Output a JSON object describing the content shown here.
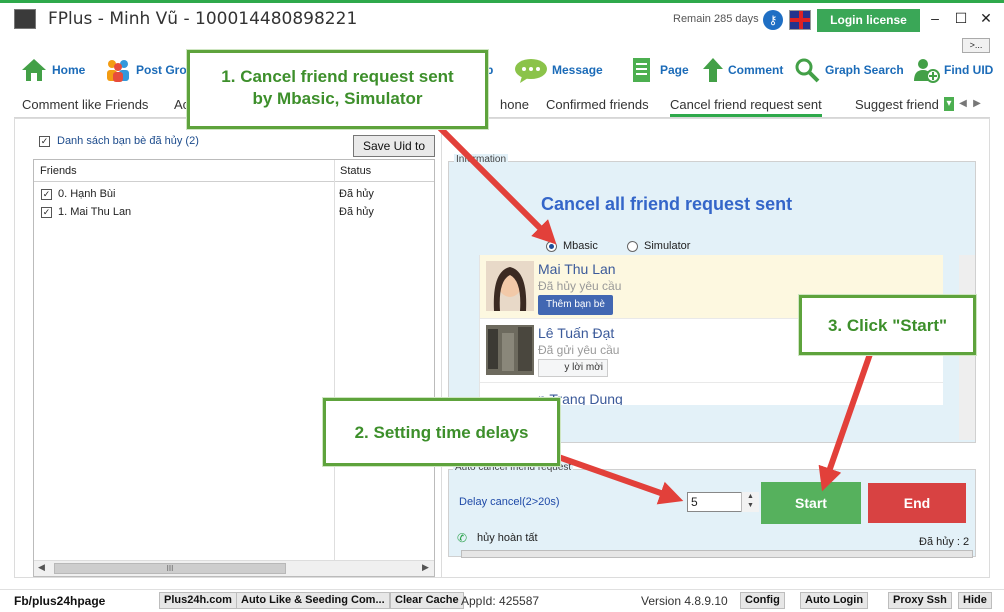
{
  "window": {
    "title": "FPlus - Minh Vũ - 100014480898221",
    "remain": "Remain 285 days",
    "login_license": "Login license",
    "more_btn": ">..."
  },
  "menu": {
    "home": "Home",
    "post_group": "Post Gro",
    "message": "Message",
    "page": "Page",
    "comment": "Comment",
    "graph_search": "Graph Search",
    "find_uid": "Find UID",
    "partial_p": "p"
  },
  "tabs": {
    "t1": "Comment like Friends",
    "t2": "Ac",
    "t3": "hone",
    "t4": "Confirmed friends",
    "t5": "Cancel friend request sent",
    "t6": "Suggest friend"
  },
  "left": {
    "checkbox_label": "Danh sách bạn bè đã hủy (2)",
    "save_uid": "Save Uid to",
    "col_friends": "Friends",
    "col_status": "Status",
    "rows": [
      {
        "name": "0. Hạnh Bùi",
        "status": "Đã hủy"
      },
      {
        "name": "1. Mai Thu Lan",
        "status": "Đã hủy"
      }
    ],
    "scroll_thumb": "III"
  },
  "right": {
    "info_label": "Information",
    "cancel_title": "Cancel all friend request sent",
    "opt_mbasic": "Mbasic",
    "opt_simulator": "Simulator",
    "preview": [
      {
        "name": "Mai Thu Lan",
        "sub": "Đã hủy yêu cầu",
        "btn": "Thêm bạn bè"
      },
      {
        "name": "Lê Tuấn Đạt",
        "sub": "Đã gửi yêu cầu",
        "btn": "y lời mời"
      },
      {
        "name": "n Trang Dung"
      }
    ],
    "auto_label": "Auto cancel friend request",
    "delay_label": "Delay cancel(2>20s)",
    "delay_value": "5",
    "start": "Start",
    "end": "End",
    "status": "hủy hoàn tất",
    "count": "Đã hủy : 2"
  },
  "statusbar": {
    "fb": "Fb/plus24hpage",
    "b1": "Plus24h.com",
    "b2": "Auto Like & Seeding Com...",
    "b3": "Clear Cache",
    "appid": "AppId: 425587",
    "version": "Version 4.8.9.10",
    "b4": "Config",
    "b5": "Auto Login",
    "b6": "Proxy Ssh",
    "b7": "Hide"
  },
  "callouts": {
    "c1_line1": "1. Cancel friend request sent",
    "c1_line2": "by Mbasic, Simulator",
    "c2": "2. Setting time delays",
    "c3": "3. Click \"Start\""
  },
  "colors": {
    "accent_green": "#3aa757",
    "link_blue": "#1b6bb8",
    "end_red": "#d84242",
    "callout_green": "#5ea33c",
    "arrow_red": "#e2403a"
  }
}
